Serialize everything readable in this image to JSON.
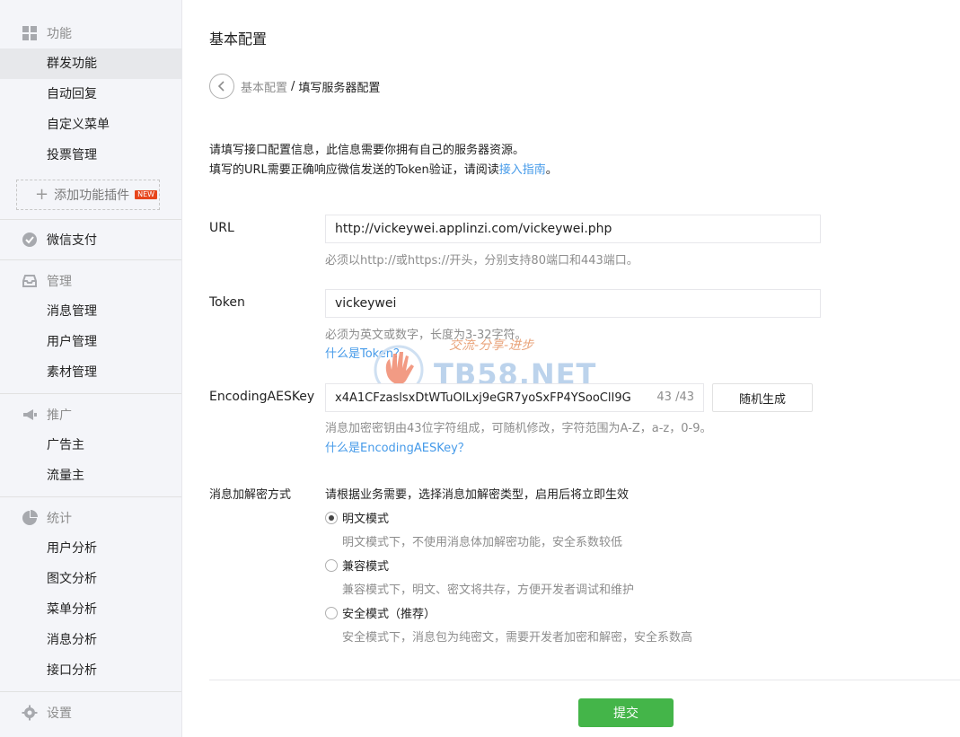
{
  "sidebar": {
    "sections": {
      "func": {
        "title": "功能",
        "items": [
          "群发功能",
          "自动回复",
          "自定义菜单",
          "投票管理"
        ],
        "add_plugin": "添加功能插件",
        "new_badge": "NEW"
      },
      "pay": {
        "title": "微信支付"
      },
      "manage": {
        "title": "管理",
        "items": [
          "消息管理",
          "用户管理",
          "素材管理"
        ]
      },
      "promo": {
        "title": "推广",
        "items": [
          "广告主",
          "流量主"
        ]
      },
      "stats": {
        "title": "统计",
        "items": [
          "用户分析",
          "图文分析",
          "菜单分析",
          "消息分析",
          "接口分析"
        ]
      },
      "settings": {
        "title": "设置"
      }
    },
    "active_item": "群发功能"
  },
  "main": {
    "page_title": "基本配置",
    "breadcrumb": {
      "parent": "基本配置",
      "separator": "/",
      "current": "填写服务器配置"
    },
    "intro": {
      "line1": "请填写接口配置信息，此信息需要你拥有自己的服务器资源。",
      "line2_prefix": "填写的URL需要正确响应微信发送的Token验证，请阅读",
      "line2_link": "接入指南",
      "line2_suffix": "。"
    },
    "url": {
      "label": "URL",
      "value": "http://vickeywei.applinzi.com/vickeywei.php",
      "hint": "必须以http://或https://开头，分别支持80端口和443端口。"
    },
    "token": {
      "label": "Token",
      "value": "vickeywei",
      "hint": "必须为英文或数字，长度为3-32字符。",
      "link": "什么是Token？"
    },
    "aeskey": {
      "label": "EncodingAESKey",
      "value": "x4A1CFzaslsxDtWTuOlLxj9eGR7yoSxFP4YSooClI9G",
      "counter": "43 /43",
      "generate_button": "随机生成",
      "hint": "消息加密密钥由43位字符组成，可随机修改，字符范围为A-Z，a-z，0-9。",
      "link": "什么是EncodingAESKey？"
    },
    "encrypt": {
      "label": "消息加解密方式",
      "intro": "请根据业务需要，选择消息加解密类型，启用后将立即生效",
      "options": [
        {
          "label": "明文模式",
          "desc": "明文模式下，不使用消息体加解密功能，安全系数较低",
          "checked": true
        },
        {
          "label": "兼容模式",
          "desc": "兼容模式下，明文、密文将共存，方便开发者调试和维护",
          "checked": false
        },
        {
          "label": "安全模式（推荐）",
          "desc": "安全模式下，消息包为纯密文，需要开发者加密和解密，安全系数高",
          "checked": false
        }
      ]
    },
    "submit_label": "提交"
  },
  "watermark": {
    "slogan": "交流-分享-进步",
    "site": "TB58.NET"
  },
  "colors": {
    "accent_green": "#44b549",
    "link_blue": "#459ae9",
    "hint_gray": "#8d8d8d",
    "sidebar_bg": "#f4f5f9"
  }
}
